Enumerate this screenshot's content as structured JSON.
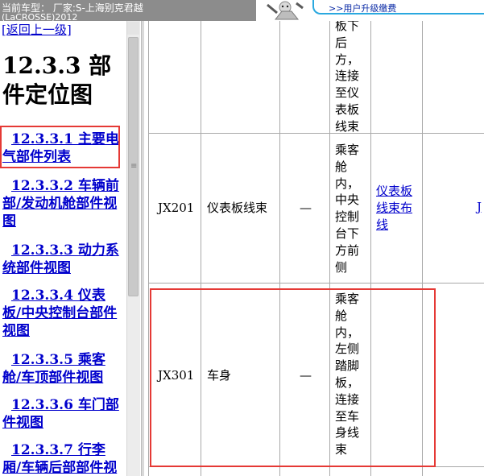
{
  "header": {
    "car_model_label": "当前车型： 厂家:S-上海别克君越",
    "car_model_sub": "(LaCROSSE)2012",
    "upgrade_link": ">>用户升级缴费"
  },
  "nav": {
    "back_link": "[返回上一级]",
    "section_title": "12.3.3 部件定位图",
    "items": [
      {
        "label": "12.3.3.1 主要电气部件列表"
      },
      {
        "label": "12.3.3.2 车辆前部/发动机舱部件视图"
      },
      {
        "label": "12.3.3.3 动力系统部件视图"
      },
      {
        "label": "12.3.3.4 仪表板/中央控制台部件视图"
      },
      {
        "label": "12.3.3.5 乘客舱/车顶部件视图"
      },
      {
        "label": "12.3.3.6 车门部件视图"
      },
      {
        "label": "12.3.3.7 行李厢/车辆后部部件视"
      }
    ]
  },
  "table": {
    "rows": [
      {
        "id": "",
        "name": "",
        "dash": "",
        "location": "板下后方，连接至仪表板线束",
        "link": ""
      },
      {
        "id": "JX201",
        "name": "仪表板线束",
        "dash": "—",
        "location": "乘客舱内，中央控制台下方前侧",
        "link": "仪表板线束布线"
      },
      {
        "id": "JX301",
        "name": "车身",
        "dash": "—",
        "location": "乘客舱内，左侧踏脚板，连接至车身线束",
        "link": ""
      }
    ],
    "cut_link": "J"
  }
}
